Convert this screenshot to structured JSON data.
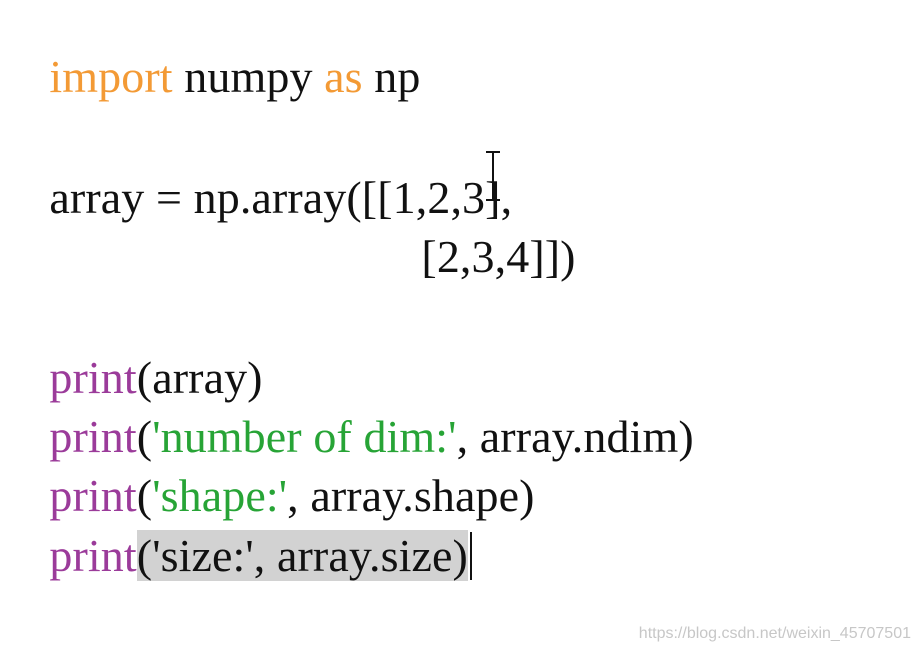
{
  "code": {
    "import_kw": "import",
    "module": " numpy ",
    "as_kw": "as",
    "alias": " np",
    "array_line_1": "array = np.array([[1,2,3],",
    "array_line_2": "[2,3,4]])",
    "print_1_fn": "print",
    "print_1_rest": "(array)",
    "print_2_fn": "print",
    "print_2_open": "(",
    "print_2_string": "'number of dim:'",
    "print_2_rest": ", array.ndim)",
    "print_3_fn": "print",
    "print_3_open": "(",
    "print_3_string": "'shape:'",
    "print_3_rest": ", array.shape)",
    "print_4_fn": "print",
    "print_4_selected": "('size:', array.size)"
  },
  "watermark": "https://blog.csdn.net/weixin_45707501",
  "colors": {
    "keyword": "#f39a35",
    "function": "#9b3b9a",
    "string": "#27a436",
    "text": "#111111",
    "selection": "#d2d2d2"
  },
  "icons": {
    "cursor": "text-cursor-icon",
    "caret": "insertion-caret"
  }
}
